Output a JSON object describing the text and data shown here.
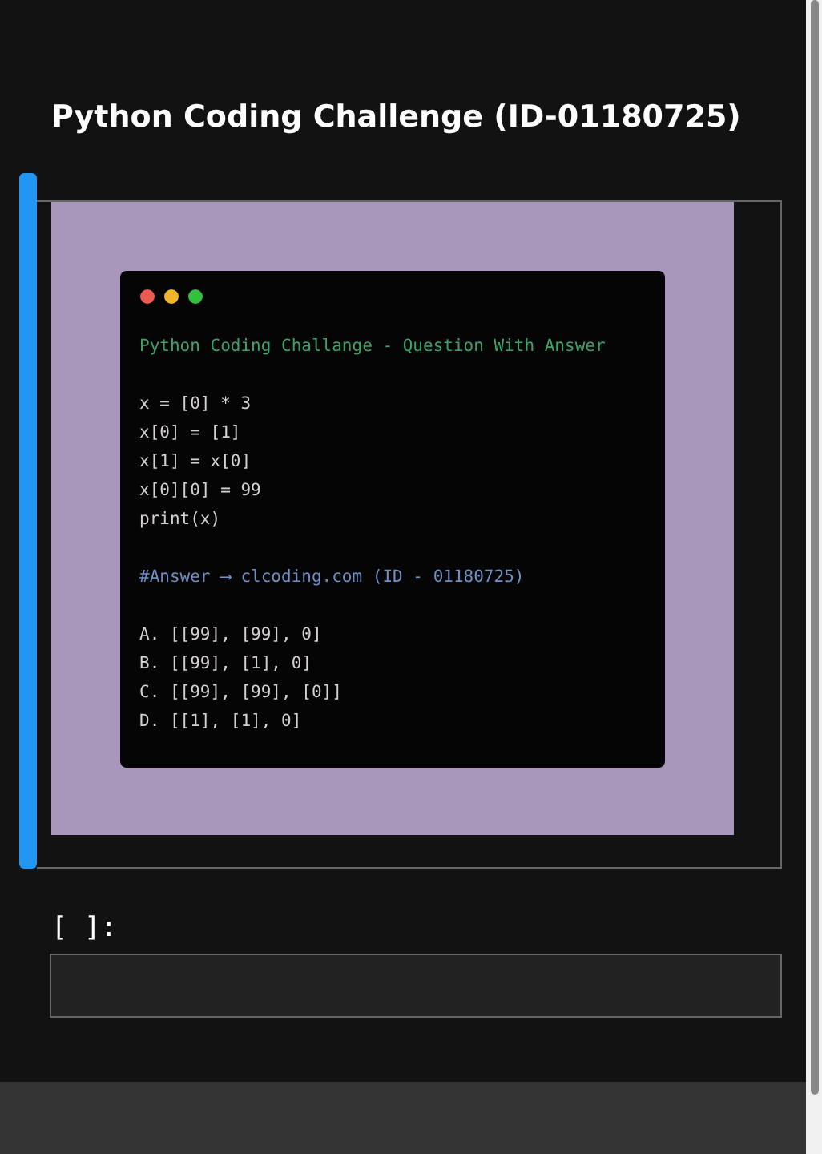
{
  "title": "Python Coding Challenge (ID-01180725)",
  "output_cell": {
    "code_image": {
      "heading": "Python Coding Challange - Question With Answer",
      "code_lines": [
        "x = [0] * 3",
        "x[0] = [1]",
        "x[1] = x[0]",
        "x[0][0] = 99",
        "print(x)"
      ],
      "answer_line": "#Answer ⟶ clcoding.com (ID - 01180725)",
      "options": [
        "A. [[99], [99], 0]",
        "B. [[99], [1], 0]",
        "C. [[99], [99], [0]]",
        "D. [[1], [1], 0]"
      ]
    }
  },
  "input_cell": {
    "prompt": "[ ]:"
  }
}
